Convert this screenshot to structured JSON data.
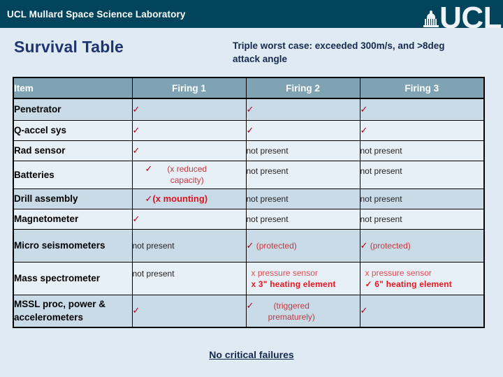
{
  "banner": {
    "title": "UCL Mullard Space Science Laboratory",
    "logo_text": "UCL",
    "logo_icon": "ucl-dome-icon"
  },
  "slide": {
    "title": "Survival Table",
    "subtitle": "Triple worst case: exceeded 300m/s, and >8deg attack angle",
    "footer": "No critical failures"
  },
  "table": {
    "columns": [
      "Item",
      "Firing 1",
      "Firing 2",
      "Firing 3"
    ],
    "rows": [
      {
        "item": "Penetrator",
        "f1": {
          "tick": "✓",
          "note": ""
        },
        "f2": {
          "tick": "✓",
          "note": ""
        },
        "f3": {
          "tick": "✓",
          "note": ""
        }
      },
      {
        "item": "Q-accel sys",
        "f1": {
          "tick": "✓",
          "note": ""
        },
        "f2": {
          "tick": "✓",
          "note": ""
        },
        "f3": {
          "tick": "✓",
          "note": ""
        }
      },
      {
        "item": "Rad sensor",
        "f1": {
          "tick": "✓",
          "note": ""
        },
        "f2": {
          "tick": "",
          "note": "not present"
        },
        "f3": {
          "tick": "",
          "note": "not present"
        }
      },
      {
        "item": "Batteries",
        "f1": {
          "tick": "✓",
          "note": "(x reduced capacity)"
        },
        "f2": {
          "tick": "",
          "note": "not present"
        },
        "f3": {
          "tick": "",
          "note": "not present"
        }
      },
      {
        "item": "Drill assembly",
        "f1": {
          "tick": "✓",
          "note": "(x mounting)"
        },
        "f2": {
          "tick": "",
          "note": "not present"
        },
        "f3": {
          "tick": "",
          "note": "not present"
        }
      },
      {
        "item": "Magnetometer",
        "f1": {
          "tick": "✓",
          "note": ""
        },
        "f2": {
          "tick": "",
          "note": "not present"
        },
        "f3": {
          "tick": "",
          "note": "not present"
        }
      },
      {
        "item": "Micro seismometers",
        "f1": {
          "tick": "",
          "note": "not present"
        },
        "f2": {
          "tick": "✓",
          "note": "(protected)"
        },
        "f3": {
          "tick": "✓",
          "note": "(protected)"
        }
      },
      {
        "item": "Mass spectrometer",
        "f1": {
          "tick": "",
          "note": "not present"
        },
        "f2": {
          "line1": "x  pressure sensor",
          "line2": "x 3\" heating  element"
        },
        "f3": {
          "line1": "x  pressure sensor",
          "line2": "✓ 6\" heating  element"
        }
      },
      {
        "item": "MSSL proc, power & accelerometers",
        "f1": {
          "tick": "✓",
          "note": ""
        },
        "f2": {
          "tick": "✓",
          "note": "(triggered prematurely)"
        },
        "f3": {
          "tick": "✓",
          "note": ""
        }
      }
    ]
  },
  "colors": {
    "banner_bg": "#02445b",
    "page_bg": "#dfeaf2",
    "header_row_bg": "#7fa3b3",
    "row_shade_a": "#cadbe8",
    "row_shade_b": "#e8f0f7",
    "title_blue": "#1f3571",
    "tick_red": "#b00018",
    "note_red": "#c0393f",
    "bold_red": "#e8141e"
  }
}
